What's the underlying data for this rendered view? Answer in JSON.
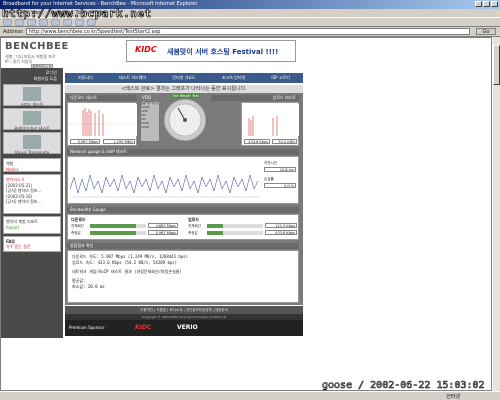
{
  "window": {
    "title": "Broadband for your Internet Services - BenchBee - Microsoft Internet Explorer"
  },
  "watermark": "http://www.bcpark.net",
  "menubar": [
    "File",
    "Edit",
    "View",
    "Favorites",
    "Tools",
    "Help"
  ],
  "address": {
    "label": "Address",
    "url": "http://www.benchbee.co.kr/Speedtest/TestStart2.asp",
    "go": "Go"
  },
  "site": {
    "logo": "BENCHBEE",
    "sub_line1": "레벨 : 미니포털서 체험중 포르",
    "sub_line2": "IP : 경기 지원지",
    "login": "회원정보수정"
  },
  "banner": {
    "brand": "KIDC",
    "text": "새봄맞이 서버 호스팅 Festival !!!!"
  },
  "nav": [
    "커뮤니티",
    "테스트 하드웨어",
    "인터넷 가요도",
    "초고속 인터넷",
    "ISP 고르기"
  ],
  "sidebar": {
    "menu1": "로그인",
    "menu2": "회원가입 도움",
    "card1": "스피드 테스트",
    "card2": "클레이어 회선 테스트",
    "card3": "Visual Traceroute",
    "notice_label": "체험",
    "notice_sub": "Notice",
    "news_title": "벤치비소식",
    "news1_date": "(2002-05-21)",
    "news1": "[공지] 벤치비 정보...",
    "news2_date": "(2002-05-16)",
    "news2": "[공지] 벤치비 정보...",
    "report_title": "벤치비 체험 리포트",
    "report": "Report",
    "faq": "FAQ",
    "faq_sub": "자주 묻는 질문"
  },
  "test": {
    "message": "<테스트 완료> 결과는 그래프가 나타나는 동안 표시됩니다.",
    "download_label": "다운로드 테스트",
    "upload_label": "업로드 테스트",
    "download_mbps": "5.987 Mbps",
    "download_mbs": "1.290 MB/s",
    "upload_kbps": "433.6 Kbps",
    "upload_kbs": "54.2 KB/s",
    "capacity_label": "VDD Capacity",
    "capacity_levels": [
      "100M",
      "10M",
      "5M",
      "1M",
      "500K",
      "100K"
    ],
    "gauge_note": "The Whole",
    "gauge_test": "Test",
    "network_label": "Network gauge & VoIP 테스트",
    "latency_label": "지연시간",
    "latency_value": "20.8 ms",
    "loss_label": "손실률",
    "loss_value": "0.0 %",
    "bandwidth_label": "Bandwidth Gauge",
    "down_head": "다운로드",
    "up_head": "업로드",
    "down_total_label": "전체회선",
    "down_total_value": "4.883 Mbps",
    "down_avg_label": "측정값",
    "down_avg_value": "5.987 Mbps",
    "up_total_label": "전체회선",
    "up_total_value": "121.5 Kbps",
    "up_avg_label": "측정값",
    "up_avg_value": "433.6 Kbps",
    "down_fill": 0.82,
    "up_fill": 0.28,
    "result_label": "종합결과 확인",
    "result_line1": "다운로드 속도:     5.987 Mbps (1.249 MB/s, 1268443 bps)",
    "result_line2": "업로드 속도:       433.6 Kbps (54.2 KB/s, 54209 bps)",
    "result_line3": "네트워크 게임/VoIP 테스트 결과 (파킹문제회선/파킹손실율)",
    "result_line4": "평균값:",
    "result_line5": "최소값:        20.8 ms"
  },
  "footer": {
    "links": "이용약관 | 도움말 | 회사소개 | 개인정보보호정책 | 제휴문의",
    "copyright": "Copyright © 1999-2002 Intoring Information Contact Us",
    "sponsor": "Premium Sponsor :",
    "sponsor1": "KIDC",
    "sponsor2": "VERIO"
  },
  "status": {
    "zone": "인터넷"
  },
  "stamp": "goose / 2002-06-22 15:03:02"
}
